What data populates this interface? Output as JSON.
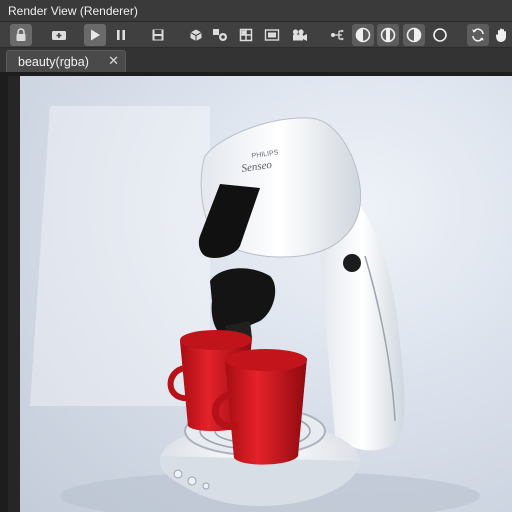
{
  "window": {
    "title": "Render View (Renderer)"
  },
  "toolbar": {
    "buttons": [
      {
        "name": "lock-icon",
        "state": "active"
      },
      {
        "name": "add-snapshot-icon",
        "state": "normal"
      },
      {
        "name": "play-icon",
        "state": "active"
      },
      {
        "name": "pause-icon",
        "state": "normal"
      },
      {
        "name": "save-icon",
        "state": "normal"
      },
      {
        "name": "cube-icon",
        "state": "normal"
      },
      {
        "name": "scene-objects-icon",
        "state": "normal"
      },
      {
        "name": "grid-layout-icon",
        "state": "normal"
      },
      {
        "name": "frame-icon",
        "state": "normal"
      },
      {
        "name": "camera-icon",
        "state": "normal"
      },
      {
        "name": "channels-icon",
        "state": "normal"
      },
      {
        "name": "contrast-left-icon",
        "state": "toggled"
      },
      {
        "name": "contrast-center-icon",
        "state": "toggled"
      },
      {
        "name": "contrast-right-icon",
        "state": "toggled"
      },
      {
        "name": "circle-outline-icon",
        "state": "normal"
      },
      {
        "name": "refresh-icon",
        "state": "toggled"
      },
      {
        "name": "hand-pan-icon",
        "state": "normal"
      }
    ]
  },
  "tabs": [
    {
      "label": "beauty(rgba)",
      "close": "✕",
      "active": true
    }
  ],
  "render": {
    "product_brand": "PHILIPS",
    "product_name": "Senseo"
  },
  "colors": {
    "accent": "#6a6a6a",
    "panel": "#404040",
    "cup_red": "#d4141c",
    "machine_white": "#f4f6f8"
  }
}
